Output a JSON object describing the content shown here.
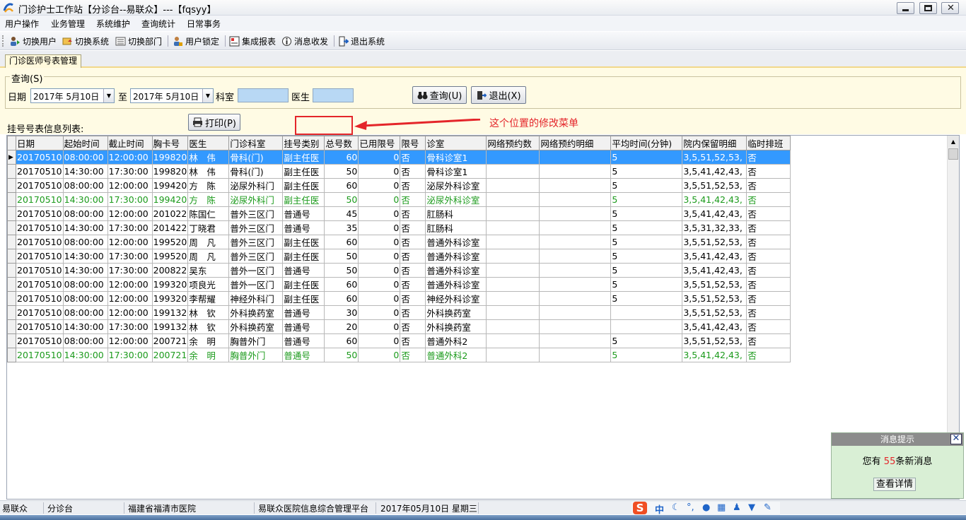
{
  "window": {
    "title": "门诊护士工作站【分诊台--易联众】---【fqsyy】"
  },
  "menu": [
    "用户操作",
    "业务管理",
    "系统维护",
    "查询统计",
    "日常事务"
  ],
  "toolbar": [
    {
      "label": "切换用户",
      "icon": "switch-user-icon"
    },
    {
      "label": "切换系统",
      "icon": "switch-system-icon"
    },
    {
      "label": "切换部门",
      "icon": "switch-department-icon"
    },
    {
      "label": "用户锁定",
      "icon": "user-lock-icon"
    },
    {
      "label": "集成报表",
      "icon": "report-icon"
    },
    {
      "label": "消息收发",
      "icon": "message-icon"
    },
    {
      "label": "退出系统",
      "icon": "exit-icon"
    }
  ],
  "tab": {
    "label": "门诊医师号表管理"
  },
  "query": {
    "legend": "查询(S)",
    "date_label": "日期",
    "date_from": "2017年 5月10日",
    "to_label": "至",
    "date_to": "2017年 5月10日",
    "dept_label": "科室",
    "doctor_label": "医生",
    "search_button": "查询(U)",
    "exit_button": "退出(X)"
  },
  "list": {
    "label": "挂号号表信息列表:",
    "print_button": "打印(P)"
  },
  "annotation": {
    "text": "这个位置的修改菜单",
    "color": "#e4252a"
  },
  "grid": {
    "columns": [
      "日期",
      "起始时间",
      "截止时间",
      "胸卡号",
      "医生",
      "门诊科室",
      "挂号类别",
      "总号数",
      "已用限号",
      "限号",
      "诊室",
      "网络预约数",
      "网络预约明细",
      "平均时间(分钟)",
      "院内保留明细",
      "临时排班"
    ],
    "rows": [
      {
        "style": "selected",
        "cells": [
          "20170510",
          "08:00:00",
          "12:00:00",
          "199820",
          "林　伟",
          "骨科(门)",
          "副主任医",
          "60",
          "0",
          "否",
          "骨科诊室1",
          "",
          "",
          "5",
          "3,5,51,52,53,",
          "否"
        ]
      },
      {
        "style": "normal",
        "cells": [
          "20170510",
          "14:30:00",
          "17:30:00",
          "199820",
          "林　伟",
          "骨科(门)",
          "副主任医",
          "50",
          "0",
          "否",
          "骨科诊室1",
          "",
          "",
          "5",
          "3,5,41,42,43,",
          "否"
        ]
      },
      {
        "style": "normal",
        "cells": [
          "20170510",
          "08:00:00",
          "12:00:00",
          "199420",
          "方　陈",
          "泌尿外科门",
          "副主任医",
          "60",
          "0",
          "否",
          "泌尿外科诊室",
          "",
          "",
          "5",
          "3,5,51,52,53,",
          "否"
        ]
      },
      {
        "style": "green",
        "cells": [
          "20170510",
          "14:30:00",
          "17:30:00",
          "199420",
          "方　陈",
          "泌尿外科门",
          "副主任医",
          "50",
          "0",
          "否",
          "泌尿外科诊室",
          "",
          "",
          "5",
          "3,5,41,42,43,",
          "否"
        ]
      },
      {
        "style": "normal",
        "cells": [
          "20170510",
          "08:00:00",
          "12:00:00",
          "201022",
          "陈国仁",
          "普外三区门",
          "普通号",
          "45",
          "0",
          "否",
          "肛肠科",
          "",
          "",
          "5",
          "3,5,41,42,43,",
          "否"
        ]
      },
      {
        "style": "normal",
        "cells": [
          "20170510",
          "14:30:00",
          "17:30:00",
          "201422",
          "丁晓君",
          "普外三区门",
          "普通号",
          "35",
          "0",
          "否",
          "肛肠科",
          "",
          "",
          "5",
          "3,5,31,32,33,",
          "否"
        ]
      },
      {
        "style": "normal",
        "cells": [
          "20170510",
          "08:00:00",
          "12:00:00",
          "199520",
          "周　凡",
          "普外三区门",
          "副主任医",
          "60",
          "0",
          "否",
          "普通外科诊室",
          "",
          "",
          "5",
          "3,5,51,52,53,",
          "否"
        ]
      },
      {
        "style": "normal",
        "cells": [
          "20170510",
          "14:30:00",
          "17:30:00",
          "199520",
          "周　凡",
          "普外三区门",
          "副主任医",
          "50",
          "0",
          "否",
          "普通外科诊室",
          "",
          "",
          "5",
          "3,5,41,42,43,",
          "否"
        ]
      },
      {
        "style": "normal",
        "cells": [
          "20170510",
          "14:30:00",
          "17:30:00",
          "200822",
          "吴东",
          "普外一区门",
          "普通号",
          "50",
          "0",
          "否",
          "普通外科诊室",
          "",
          "",
          "5",
          "3,5,41,42,43,",
          "否"
        ]
      },
      {
        "style": "normal",
        "cells": [
          "20170510",
          "08:00:00",
          "12:00:00",
          "199320",
          "项良光",
          "普外一区门",
          "副主任医",
          "60",
          "0",
          "否",
          "普通外科诊室",
          "",
          "",
          "5",
          "3,5,51,52,53,",
          "否"
        ]
      },
      {
        "style": "normal",
        "cells": [
          "20170510",
          "08:00:00",
          "12:00:00",
          "199320",
          "李帮耀",
          "神经外科门",
          "副主任医",
          "60",
          "0",
          "否",
          "神经外科诊室",
          "",
          "",
          "5",
          "3,5,51,52,53,",
          "否"
        ]
      },
      {
        "style": "normal",
        "cells": [
          "20170510",
          "08:00:00",
          "12:00:00",
          "199132",
          "林　钦",
          "外科换药室",
          "普通号",
          "30",
          "0",
          "否",
          "外科换药室",
          "",
          "",
          "",
          "3,5,51,52,53,",
          "否"
        ]
      },
      {
        "style": "normal",
        "cells": [
          "20170510",
          "14:30:00",
          "17:30:00",
          "199132",
          "林　钦",
          "外科换药室",
          "普通号",
          "20",
          "0",
          "否",
          "外科换药室",
          "",
          "",
          "",
          "3,5,41,42,43,",
          "否"
        ]
      },
      {
        "style": "normal",
        "cells": [
          "20170510",
          "08:00:00",
          "12:00:00",
          "200721",
          "余　明",
          "胸普外门",
          "普通号",
          "60",
          "0",
          "否",
          "普通外科2",
          "",
          "",
          "5",
          "3,5,51,52,53,",
          "否"
        ]
      },
      {
        "style": "green",
        "cells": [
          "20170510",
          "14:30:00",
          "17:30:00",
          "200721",
          "余　明",
          "胸普外门",
          "普通号",
          "50",
          "0",
          "否",
          "普通外科2",
          "",
          "",
          "5",
          "3,5,41,42,43,",
          "否"
        ]
      }
    ]
  },
  "notification": {
    "title": "消息提示",
    "prefix": "您有",
    "count": "55",
    "suffix": "条新消息",
    "view_button": "查看详情"
  },
  "statusbar": [
    "易联众",
    "分诊台",
    "福建省福清市医院",
    "易联众医院信息综合管理平台",
    "2017年05月10日 星期三"
  ],
  "ime": {
    "mode": "中"
  }
}
